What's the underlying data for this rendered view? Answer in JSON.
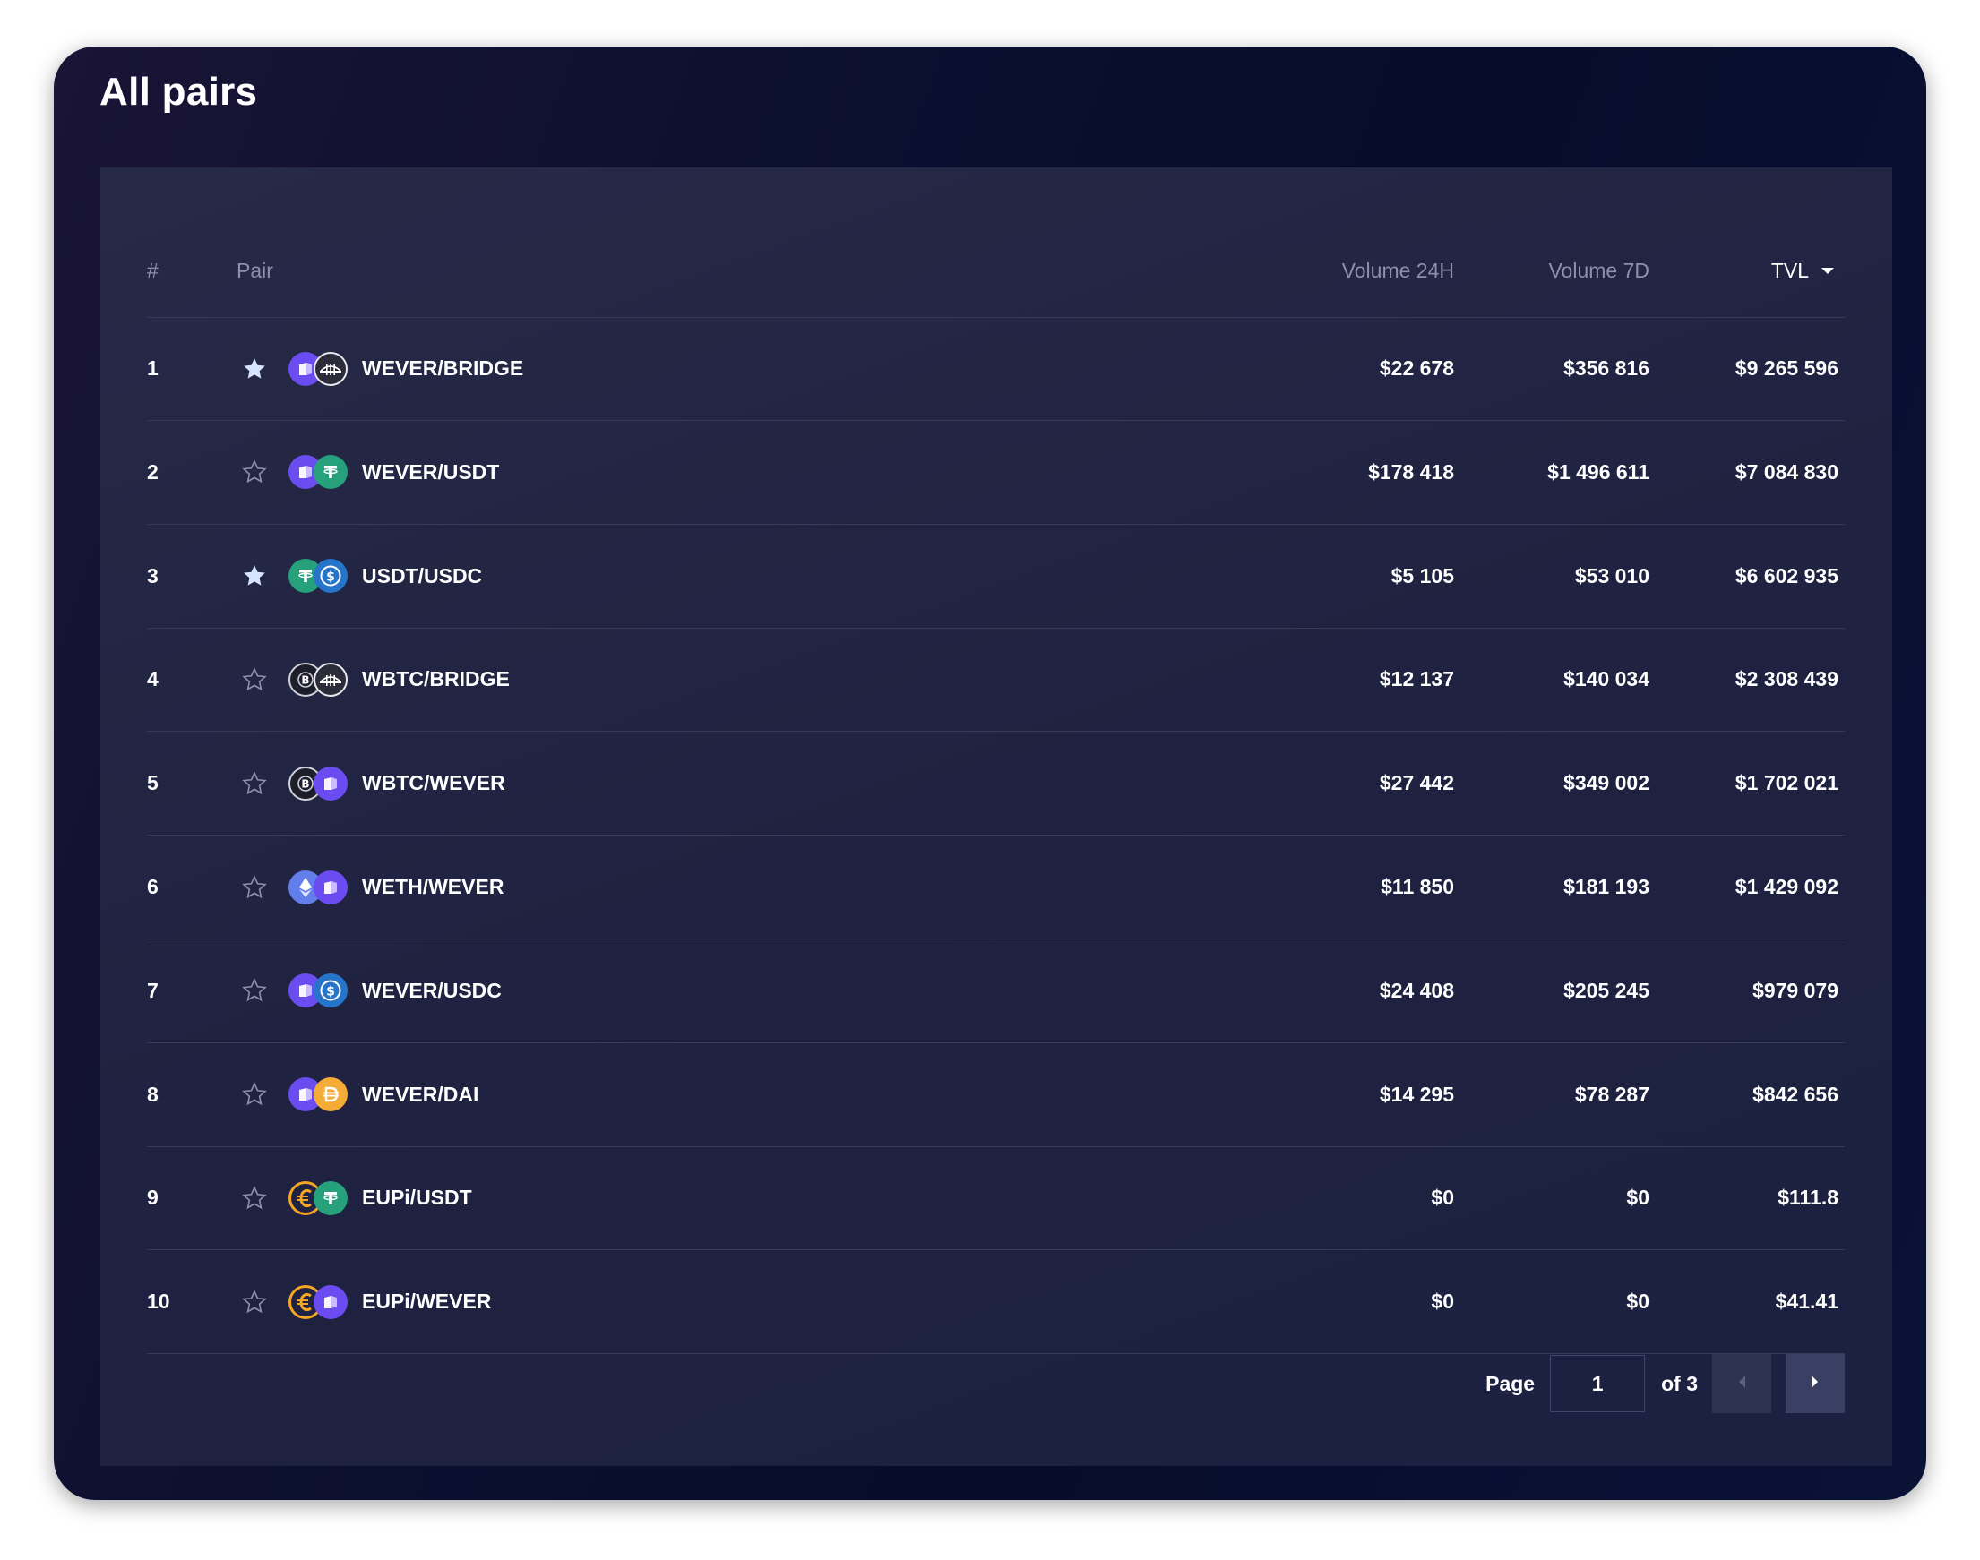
{
  "title": "All pairs",
  "columns": {
    "num": "#",
    "pair": "Pair",
    "volume_24h": "Volume 24H",
    "volume_7d": "Volume 7D",
    "tvl": "TVL"
  },
  "sort": {
    "column": "TVL",
    "direction": "descending"
  },
  "rows": [
    {
      "num": "1",
      "favorite": true,
      "token_a": "wever",
      "token_b": "bridge",
      "pair": "WEVER/BRIDGE",
      "volume_24h": "$22 678",
      "volume_7d": "$356 816",
      "tvl": "$9 265 596"
    },
    {
      "num": "2",
      "favorite": false,
      "token_a": "wever",
      "token_b": "usdt",
      "pair": "WEVER/USDT",
      "volume_24h": "$178 418",
      "volume_7d": "$1 496 611",
      "tvl": "$7 084 830"
    },
    {
      "num": "3",
      "favorite": true,
      "token_a": "usdt",
      "token_b": "usdc",
      "pair": "USDT/USDC",
      "volume_24h": "$5 105",
      "volume_7d": "$53 010",
      "tvl": "$6 602 935"
    },
    {
      "num": "4",
      "favorite": false,
      "token_a": "wbtc",
      "token_b": "bridge",
      "pair": "WBTC/BRIDGE",
      "volume_24h": "$12 137",
      "volume_7d": "$140 034",
      "tvl": "$2 308 439"
    },
    {
      "num": "5",
      "favorite": false,
      "token_a": "wbtc",
      "token_b": "wever",
      "pair": "WBTC/WEVER",
      "volume_24h": "$27 442",
      "volume_7d": "$349 002",
      "tvl": "$1 702 021"
    },
    {
      "num": "6",
      "favorite": false,
      "token_a": "weth",
      "token_b": "wever",
      "pair": "WETH/WEVER",
      "volume_24h": "$11 850",
      "volume_7d": "$181 193",
      "tvl": "$1 429 092"
    },
    {
      "num": "7",
      "favorite": false,
      "token_a": "wever",
      "token_b": "usdc",
      "pair": "WEVER/USDC",
      "volume_24h": "$24 408",
      "volume_7d": "$205 245",
      "tvl": "$979 079"
    },
    {
      "num": "8",
      "favorite": false,
      "token_a": "wever",
      "token_b": "dai",
      "pair": "WEVER/DAI",
      "volume_24h": "$14 295",
      "volume_7d": "$78 287",
      "tvl": "$842 656"
    },
    {
      "num": "9",
      "favorite": false,
      "token_a": "eupi",
      "token_b": "usdt",
      "pair": "EUPi/USDT",
      "volume_24h": "$0",
      "volume_7d": "$0",
      "tvl": "$111.8"
    },
    {
      "num": "10",
      "favorite": false,
      "token_a": "eupi",
      "token_b": "wever",
      "pair": "EUPi/WEVER",
      "volume_24h": "$0",
      "volume_7d": "$0",
      "tvl": "$41.41"
    }
  ],
  "pagination": {
    "page_label": "Page",
    "current_page": "1",
    "of_label": "of 3",
    "prev_icon": "chevron-left-icon",
    "next_icon": "chevron-right-icon"
  },
  "colors": {
    "star_filled": "#d6e4ff",
    "star_outline": "#8c90a8",
    "wever": "#6a4cf0",
    "usdt": "#26a17b",
    "usdc": "#2775ca",
    "dai": "#f5ac37",
    "eupi": "#f5a623",
    "weth": "#627eea",
    "wbtc": "#1e1e2a",
    "bridge": "#2b2b3a"
  }
}
